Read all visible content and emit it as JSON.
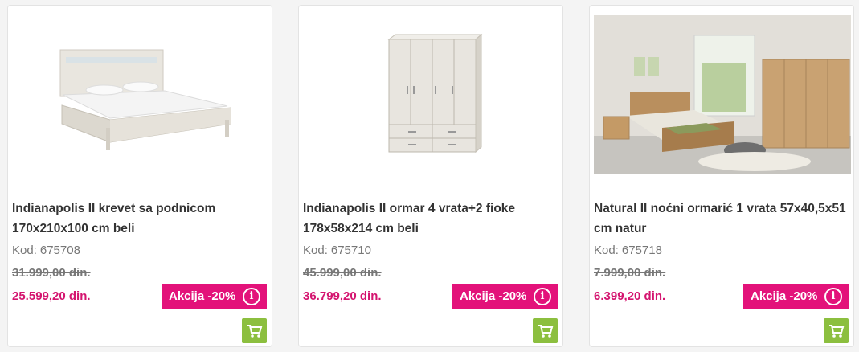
{
  "products": [
    {
      "title": "Indianapolis II krevet sa podnicom 170x210x100 cm beli",
      "code_label": "Kod:",
      "code": "675708",
      "old_price": "31.999,00 din.",
      "new_price": "25.599,20 din.",
      "badge": "Akcija -20%",
      "image": "bed-photo"
    },
    {
      "title": "Indianapolis II ormar 4 vrata+2 fioke 178x58x214 cm beli",
      "code_label": "Kod:",
      "code": "675710",
      "old_price": "45.999,00 din.",
      "new_price": "36.799,20 din.",
      "badge": "Akcija -20%",
      "image": "wardrobe-photo"
    },
    {
      "title": "Natural II noćni ormarić 1 vrata 57x40,5x51 cm natur",
      "code_label": "Kod:",
      "code": "675718",
      "old_price": "7.999,00 din.",
      "new_price": "6.399,20 din.",
      "badge": "Akcija -20%",
      "image": "bedroom-photo"
    }
  ],
  "colors": {
    "accent_pink": "#e3127a",
    "price_pink": "#d4146f",
    "cart_green": "#8cbf3f"
  },
  "icons": [
    "info-icon",
    "cart-icon"
  ]
}
